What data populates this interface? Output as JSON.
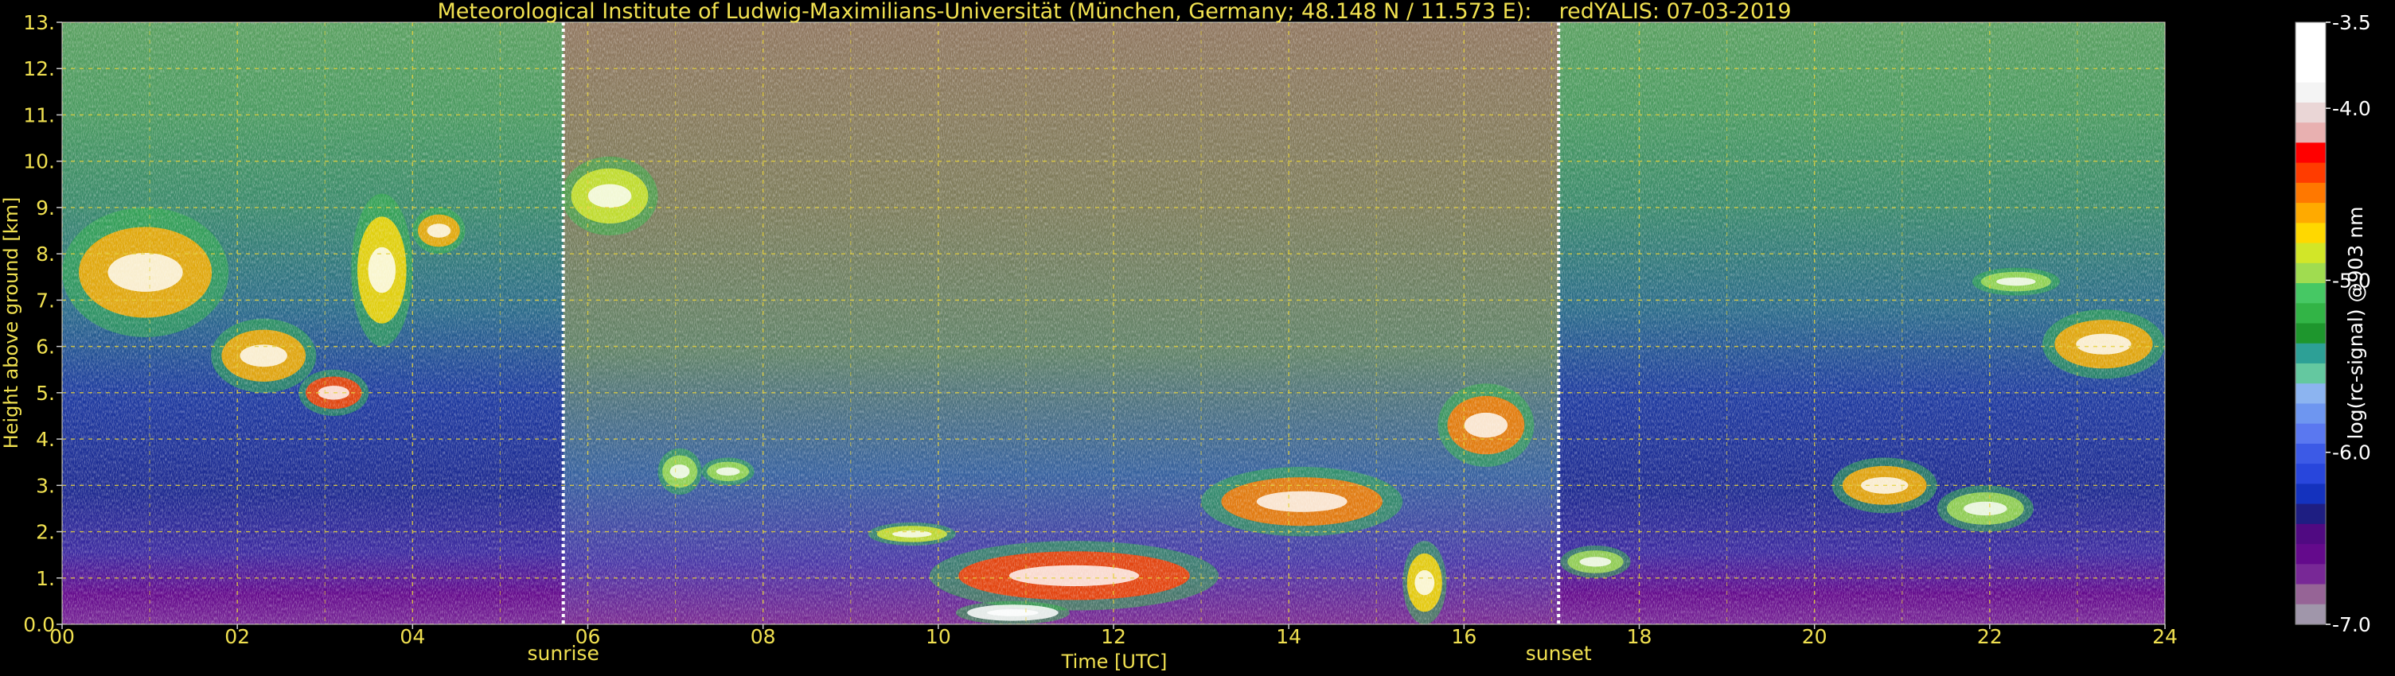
{
  "chart_data": {
    "type": "heatmap",
    "title": "Meteorological Institute of Ludwig-Maximilians-Universität (München, Germany; 48.148 N / 11.573 E):    redYALIS: 07-03-2019",
    "xlabel": "Time [UTC]",
    "ylabel": "Height above ground [km]",
    "xlim": [
      0,
      24
    ],
    "ylim": [
      0,
      13
    ],
    "xticks": [
      "00",
      "02",
      "04",
      "06",
      "08",
      "10",
      "12",
      "14",
      "16",
      "18",
      "20",
      "22",
      "24"
    ],
    "xtick_values": [
      0,
      2,
      4,
      6,
      8,
      10,
      12,
      14,
      16,
      18,
      20,
      22,
      24
    ],
    "yticks": [
      "0.0",
      "1.",
      "2.",
      "3.",
      "4.",
      "5.",
      "6.",
      "7.",
      "8.",
      "9.",
      "10.",
      "11.",
      "12.",
      "13."
    ],
    "ytick_values": [
      0,
      1,
      2,
      3,
      4,
      5,
      6,
      7,
      8,
      9,
      10,
      11,
      12,
      13
    ],
    "grid": true,
    "colorbar": {
      "label": "log(rc-signal) @903 nm",
      "range": [
        -7.0,
        -3.5
      ],
      "ticks": [
        "-3.5",
        "-4.0",
        "-5.0",
        "-6.0",
        "-7.0"
      ],
      "tick_values": [
        -3.5,
        -4.0,
        -5.0,
        -6.0,
        -7.0
      ],
      "colors": [
        "#ffffff",
        "#ffffff",
        "#ffffff",
        "#f4f4f4",
        "#ead6d6",
        "#e8b0b0",
        "#ff0000",
        "#ff3c00",
        "#ff7800",
        "#ffaa00",
        "#ffd800",
        "#d2e628",
        "#a0dc50",
        "#46c864",
        "#32b446",
        "#1e962d",
        "#2da096",
        "#64c8a0",
        "#8cb4f0",
        "#6e96f0",
        "#5a78f0",
        "#3c5ae6",
        "#2846dc",
        "#1432be",
        "#1e1e82",
        "#500a82",
        "#640a8c",
        "#782896",
        "#966496",
        "#a096aa"
      ]
    },
    "vlines": [
      {
        "x": 5.72,
        "label": "sunrise"
      },
      {
        "x": 17.08,
        "label": "sunset"
      }
    ],
    "features": [
      {
        "x": [
          0.0,
          1.9
        ],
        "y": [
          6.2,
          9.0
        ],
        "level": -4.6
      },
      {
        "x": [
          1.7,
          2.9
        ],
        "y": [
          5.0,
          6.6
        ],
        "level": -4.6
      },
      {
        "x": [
          2.7,
          3.5
        ],
        "y": [
          4.5,
          5.5
        ],
        "level": -4.4
      },
      {
        "x": [
          3.3,
          4.0
        ],
        "y": [
          6.0,
          9.3
        ],
        "level": -4.7
      },
      {
        "x": [
          4.0,
          4.6
        ],
        "y": [
          8.0,
          9.0
        ],
        "level": -4.6
      },
      {
        "x": [
          5.7,
          6.8
        ],
        "y": [
          8.4,
          10.1
        ],
        "level": -4.8
      },
      {
        "x": [
          6.8,
          7.3
        ],
        "y": [
          2.8,
          3.8
        ],
        "level": -4.9
      },
      {
        "x": [
          7.3,
          7.9
        ],
        "y": [
          3.0,
          3.6
        ],
        "level": -4.9
      },
      {
        "x": [
          9.2,
          10.2
        ],
        "y": [
          1.7,
          2.2
        ],
        "level": -4.8
      },
      {
        "x": [
          9.9,
          13.2
        ],
        "y": [
          0.3,
          1.8
        ],
        "level": -4.4
      },
      {
        "x": [
          10.2,
          11.5
        ],
        "y": [
          0.0,
          0.5
        ],
        "level": -3.6
      },
      {
        "x": [
          13.0,
          15.3
        ],
        "y": [
          1.9,
          3.4
        ],
        "level": -4.5
      },
      {
        "x": [
          15.3,
          15.8
        ],
        "y": [
          0.0,
          1.8
        ],
        "level": -4.7
      },
      {
        "x": [
          15.7,
          16.8
        ],
        "y": [
          3.4,
          5.2
        ],
        "level": -4.5
      },
      {
        "x": [
          17.1,
          17.9
        ],
        "y": [
          1.0,
          1.7
        ],
        "level": -4.9
      },
      {
        "x": [
          20.2,
          21.4
        ],
        "y": [
          2.4,
          3.6
        ],
        "level": -4.6
      },
      {
        "x": [
          21.4,
          22.5
        ],
        "y": [
          2.0,
          3.0
        ],
        "level": -4.9
      },
      {
        "x": [
          22.6,
          24.0
        ],
        "y": [
          5.3,
          6.8
        ],
        "level": -4.6
      },
      {
        "x": [
          21.8,
          22.8
        ],
        "y": [
          7.1,
          7.7
        ],
        "level": -5.0
      }
    ]
  }
}
